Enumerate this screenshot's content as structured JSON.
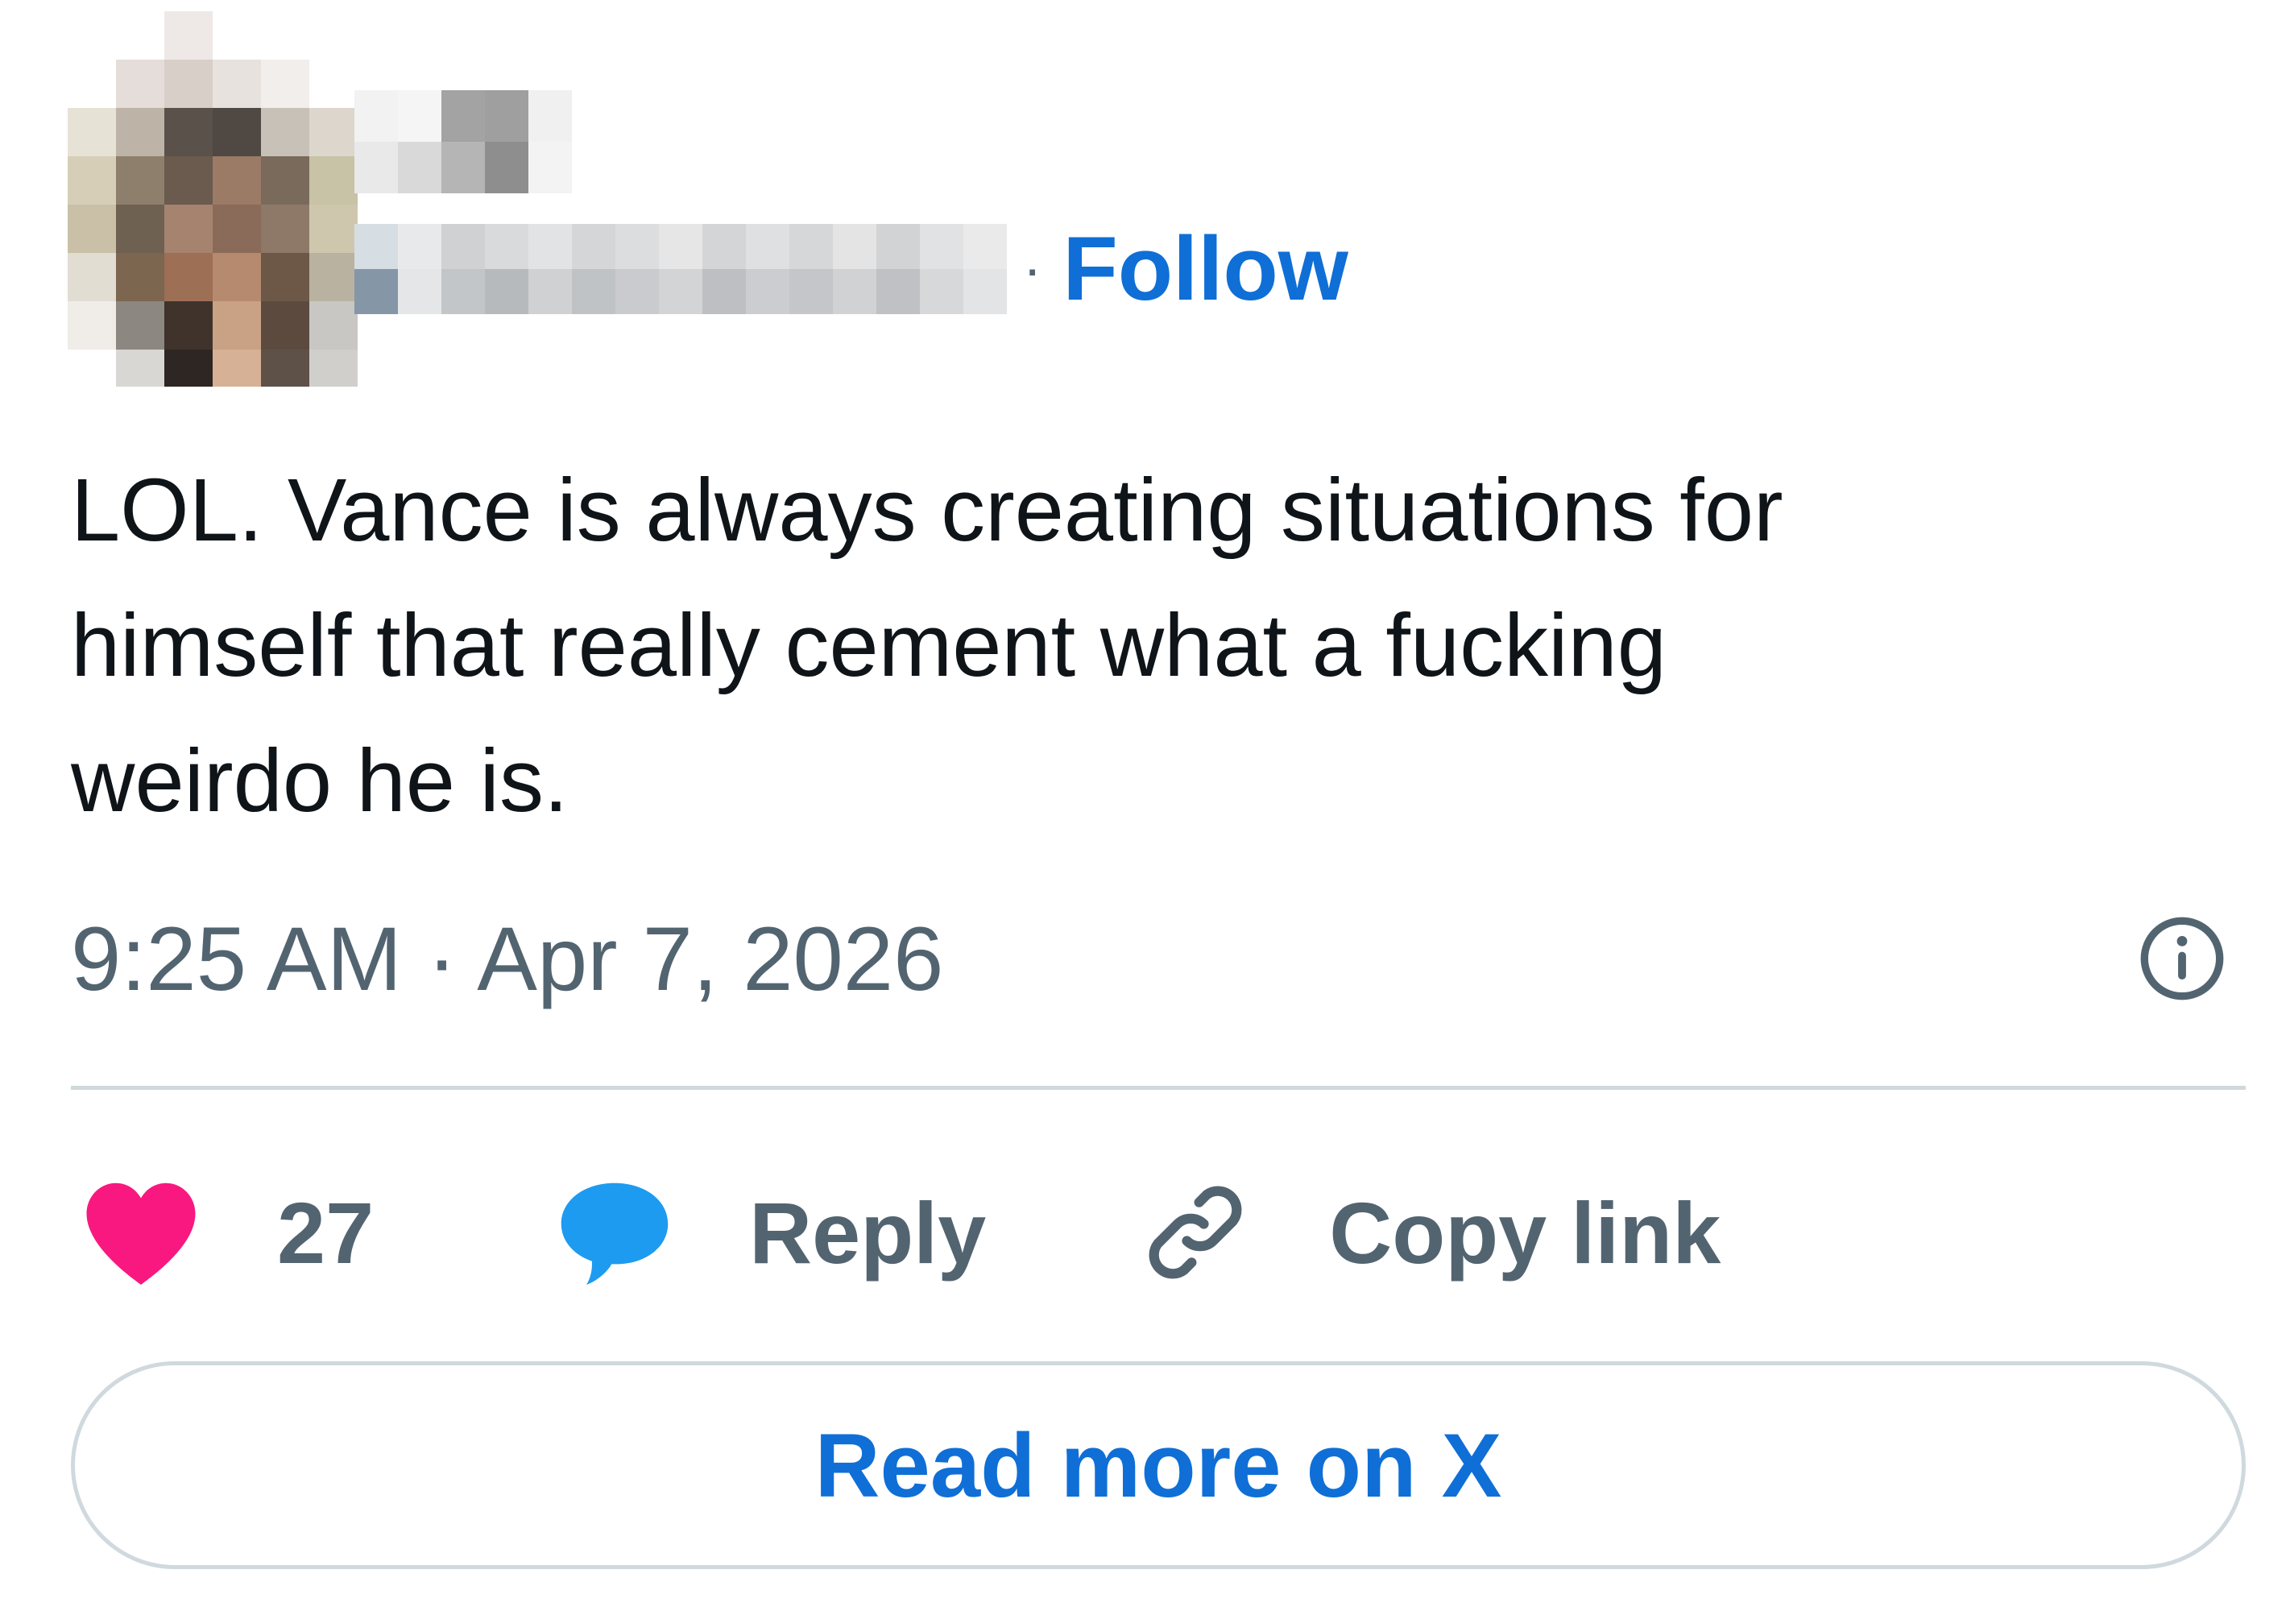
{
  "header": {
    "separator": "·",
    "follow_label": "Follow"
  },
  "tweet": {
    "text": "LOL. Vance is always creating situations for\nhimself that really cement what a fucking\nweirdo he is.",
    "timestamp": "9:25 AM · Apr 7, 2026"
  },
  "actions": {
    "like_count": "27",
    "reply_label": "Reply",
    "copy_link_label": "Copy link"
  },
  "footer": {
    "read_more_label": "Read more on X"
  },
  "icons": {
    "info": "info-circle-icon",
    "like": "heart-icon",
    "reply": "speech-bubble-icon",
    "copy_link": "link-icon"
  },
  "colors": {
    "accent": "#0f6fd6",
    "heart": "#f91880",
    "reply_bubble": "#1d9bf0",
    "secondary_text": "#536471",
    "primary_text": "#0f1419",
    "border": "#cfd9de"
  }
}
